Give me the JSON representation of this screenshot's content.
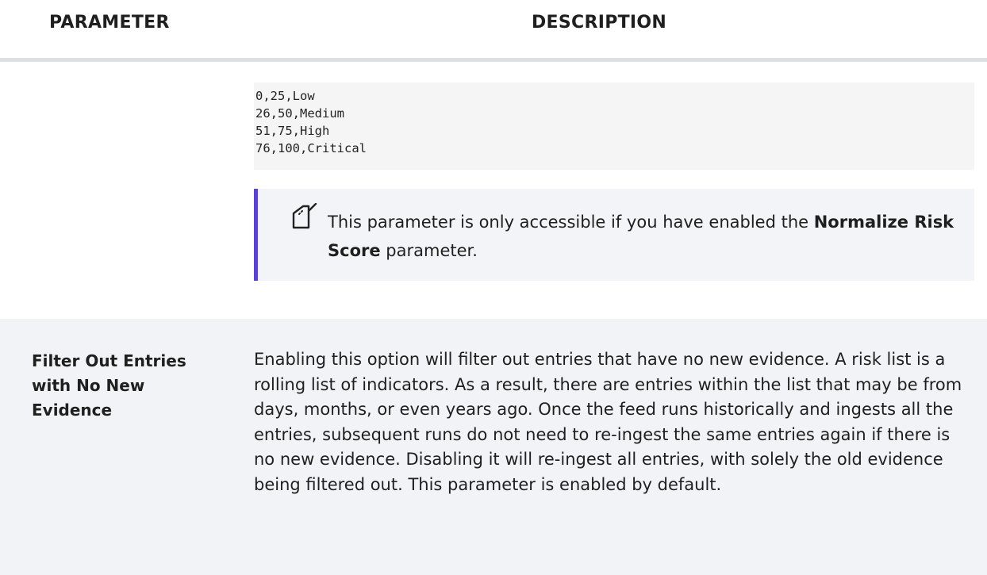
{
  "table_header": {
    "parameter": "PARAMETER",
    "description": "DESCRIPTION"
  },
  "code_lines": [
    "0,25,Low",
    "26,50,Medium",
    "51,75,High",
    "76,100,Critical"
  ],
  "note": {
    "icon": "note-pencil-icon",
    "text_before": "This parameter is only accessible if you have enabled the ",
    "bold": "Normalize Risk Score",
    "text_after": " parameter.",
    "accent_color": "#5b3fe0"
  },
  "row": {
    "parameter": "Filter Out Entries with No New Evidence",
    "description": "Enabling this option will filter out entries that have no new evidence. A risk list is a rolling list of indicators. As a result, there are entries within the list that may be from days, months, or even years ago. Once the feed runs historically and ingests all the entries, subsequent runs do not need to re-ingest the same entries again if there is no new evidence. Disabling it will re-ingest all entries, with solely the old evidence being filtered out.  This parameter is enabled by default."
  }
}
